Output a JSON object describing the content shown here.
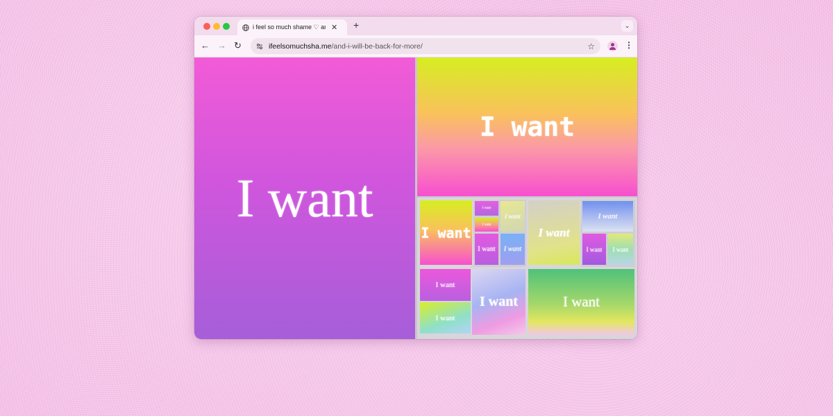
{
  "browser": {
    "tab_title": "i feel so much shame ♡ and i",
    "close_glyph": "✕",
    "newtab_glyph": "+",
    "tabmenu_glyph": "⌄",
    "back_glyph": "←",
    "forward_glyph": "→",
    "reload_glyph": "↻",
    "url_domain": "ifeelsomuchsha.me",
    "url_path": "/and-i-will-be-back-for-more/",
    "star_glyph": "☆",
    "menu_glyph": "⋮",
    "icons": [
      "globe-icon",
      "close-icon",
      "plus-icon",
      "chevron-down-icon",
      "back-arrow-icon",
      "forward-arrow-icon",
      "reload-icon",
      "site-settings-icon",
      "star-icon",
      "profile-icon",
      "menu-icon"
    ]
  },
  "artwork": {
    "text": "I want"
  },
  "colors": {
    "page_background": "#f4bfe6",
    "tab_bar": "#f2dced",
    "toolbar": "#fbf3f9",
    "profile_accent": "#a3338f"
  }
}
